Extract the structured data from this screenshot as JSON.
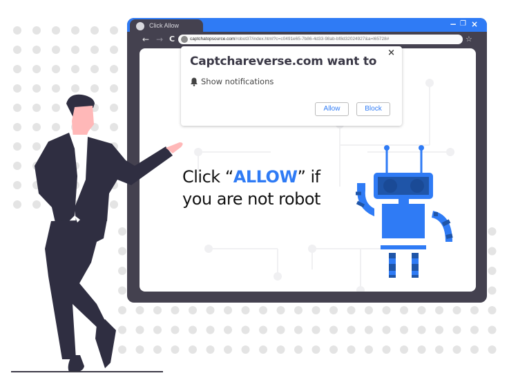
{
  "browser": {
    "tab_title": "Click Allow",
    "tab_icon": "globe-icon",
    "window_controls": [
      "minimize-icon",
      "restore-icon",
      "close-icon"
    ],
    "nav": {
      "back": "←",
      "forward": "→",
      "reload": "C"
    },
    "url_domain": "captchatopsource.com",
    "url_path": "/robot37/index.html?c=c0491e65-7b86-4d33-98ab-bf8d32024927&a=l65728#",
    "bookmark_icon": "star-icon"
  },
  "popup": {
    "title": "Captchareverse.com want to",
    "permission": "Show notifications",
    "close_label": "×",
    "allow_label": "Allow",
    "block_label": "Block"
  },
  "headline": {
    "line1_prefix": "Click “",
    "line1_highlight": "ALLOW",
    "line1_suffix": "” if",
    "line2": "you  are not robot"
  },
  "colors": {
    "accent": "#2f7bf5",
    "frame": "#44414f",
    "robot_dark": "#1f55a8",
    "suit": "#2f2e41",
    "skin": "#ffb8b8"
  }
}
